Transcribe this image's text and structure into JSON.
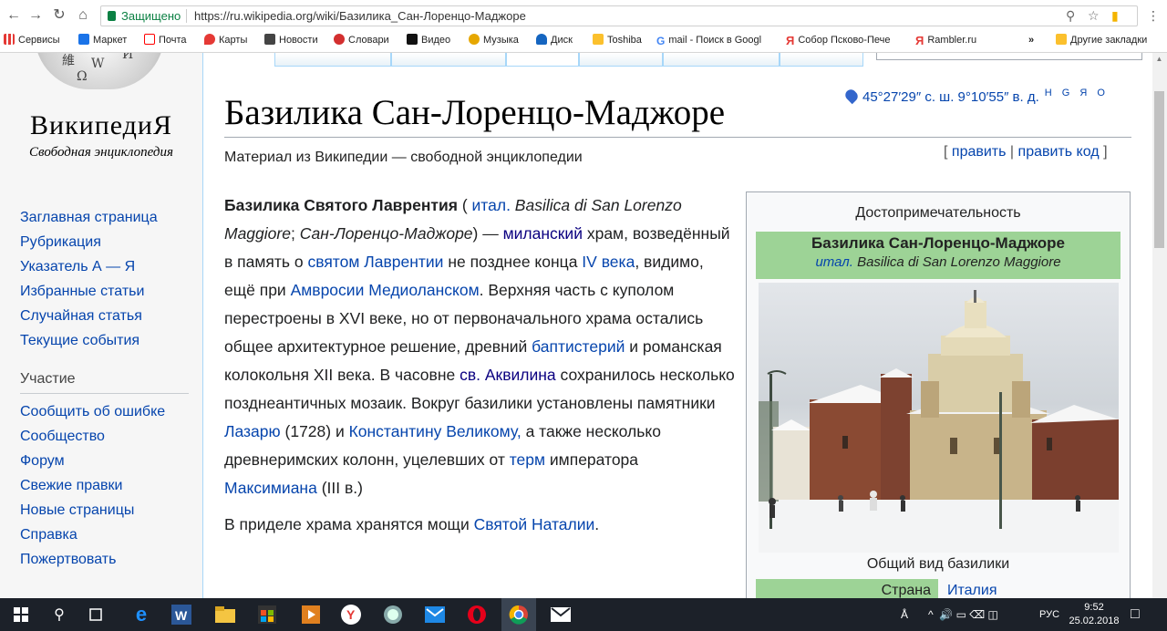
{
  "browser": {
    "security_label": "Защищено",
    "url_scheme_host": "https://ru.wikipedia.org",
    "url_path": "/wiki/Базилика_Сан-Лоренцо-Маджоре",
    "icons": [
      "back-icon",
      "forward-icon",
      "reload-icon",
      "home-icon",
      "lock-icon",
      "zoom-icon",
      "star-icon",
      "extension-icon"
    ]
  },
  "bookmarks": {
    "apps_label": "Сервисы",
    "items": [
      "Маркет",
      "Почта",
      "Карты",
      "Новости",
      "Словари",
      "Видео",
      "Музыка",
      "Диск",
      "Toshiba",
      "mail - Поиск в Googl",
      "Собор Псково-Пече",
      "Rambler.ru"
    ],
    "more_label": "»",
    "other_label": "Другие закладки",
    "colors": [
      "#1a73e8",
      "#f00",
      "#e53935",
      "#444",
      "#d32f2f",
      "#111",
      "#e6a700",
      "#1565c0",
      "#fbc02d",
      "#4285f4",
      "#e53935",
      "#1a4d9e"
    ]
  },
  "sidebar": {
    "logo_word": "ВикипедиЯ",
    "logo_tagline": "Свободная энциклопедия",
    "nav": [
      "Заглавная страница",
      "Рубрикация",
      "Указатель А — Я",
      "Избранные статьи",
      "Случайная статья",
      "Текущие события"
    ],
    "section_heading": "Участие",
    "participate": [
      "Сообщить об ошибке",
      "Сообщество",
      "Форум",
      "Свежие правки",
      "Новые страницы",
      "Справка",
      "Пожертвовать"
    ]
  },
  "article": {
    "title": "Базилика Сан-Лоренцо-Маджоре",
    "coordinates": "45°27′29″ с. ш. 9°10′55″ в. д.",
    "map_links": "H G Я O",
    "subtitle": "Материал из Википедии — свободной энциклопедии",
    "edit_open": "[",
    "edit": "править",
    "edit_sep": "|",
    "edit_code": "править код",
    "edit_close": "]",
    "p1": {
      "bold": "Базилика Святого Лаврентия",
      "t1": " ( ",
      "lang": "итал.",
      "latin": " Basilica di San Lorenzo Maggiore",
      "t2": "; ",
      "alt": "Сан-Лоренцо-Маджоре",
      "t3": ") — ",
      "l_milan": "миланский",
      "t4": " храм, возведённый в память о ",
      "l_saint": "святом Лаврентии",
      "t5": " не позднее конца ",
      "l_century": "IV века",
      "t6": ", видимо, ещё при ",
      "l_ambrose": "Амвросии Медиоланском",
      "t7": ". Верхняя часть с куполом перестроены в XVI веке, но от первоначального храма остались общее архитектурное решение, древний ",
      "l_baptistery": "баптистерий",
      "t8": " и романская колокольня XII века. В часовне ",
      "l_aquilinus": "св. Аквилина",
      "t9": " сохранилось несколько позднеантичных мозаик. Вокруг базилики установлены памятники ",
      "l_lazarus": "Лазарю",
      "t10": " (1728) и ",
      "l_constantine": "Константину Великому,",
      "t11": " а также несколько древнеримских колонн, уцелевших от ",
      "l_therm": "терм",
      "t12": " императора ",
      "l_maximian": "Максимиана",
      "t13": " (III в.)"
    },
    "p2": {
      "t1": "В приделе храма хранятся мощи ",
      "l_natalia": "Святой Наталии",
      "t2": "."
    }
  },
  "infobox": {
    "type": "Достопримечательность",
    "name": "Базилика Сан-Лоренцо-Маджоре",
    "lang": "итал.",
    "latin": " Basilica di San Lorenzo Maggiore",
    "caption": "Общий вид базилики",
    "row_label": "Страна",
    "row_value": "Италия",
    "header_color": "#9dd396"
  },
  "taskbar": {
    "tray_lang": "РУС",
    "time": "9:52",
    "date": "25.02.2018",
    "icons": [
      "windows-start-icon",
      "search-icon",
      "task-view-icon",
      "edge-icon",
      "word-icon",
      "file-explorer-icon",
      "store-icon",
      "media-player-icon",
      "yandex-browser-icon",
      "app-icon",
      "mail-icon",
      "opera-icon",
      "chrome-icon",
      "email-envelope-icon"
    ]
  }
}
